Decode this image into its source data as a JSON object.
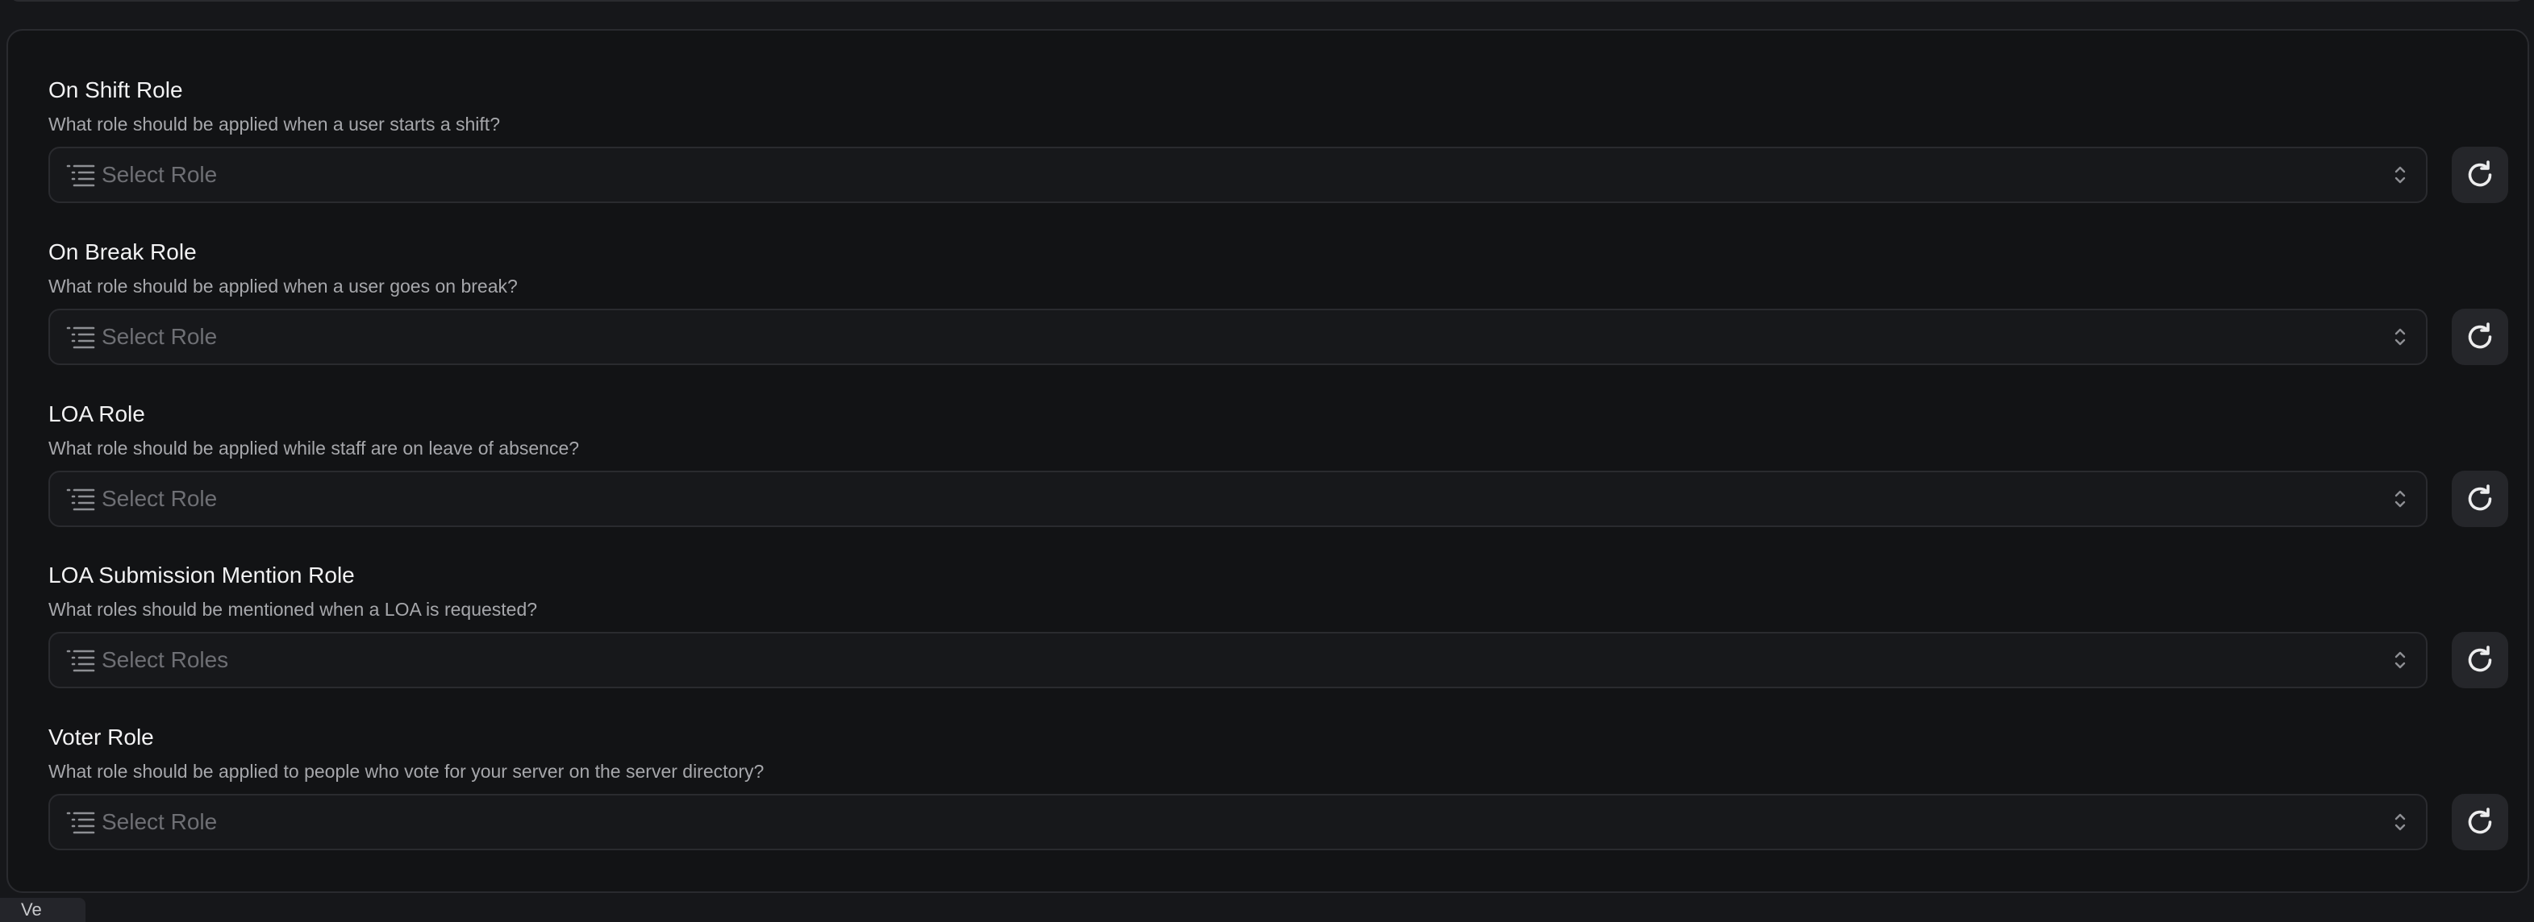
{
  "sections": [
    {
      "title": "On Shift Role",
      "description": "What role should be applied when a user starts a shift?",
      "placeholder": "Select Role"
    },
    {
      "title": "On Break Role",
      "description": "What role should be applied when a user goes on break?",
      "placeholder": "Select Role"
    },
    {
      "title": "LOA Role",
      "description": "What role should be applied while staff are on leave of absence?",
      "placeholder": "Select Role"
    },
    {
      "title": "LOA Submission Mention Role",
      "description": "What roles should be mentioned when a LOA is requested?",
      "placeholder": "Select Roles"
    },
    {
      "title": "Voter Role",
      "description": "What role should be applied to people who vote for your server on the server directory?",
      "placeholder": "Select Role"
    }
  ],
  "icons": {
    "select_leading": "list-icon",
    "select_trailing": "chevron-up-down-icon",
    "action": "refresh-icon"
  },
  "colors": {
    "page_background": "#16171a",
    "panel_background": "#121315",
    "border": "#2a2b2f",
    "title_text": "#f2f2f3",
    "description_text": "#a6a7ab",
    "placeholder_text": "#6e6f74",
    "button_background": "#25262a"
  },
  "bottom_tab": {
    "label": "Ve"
  }
}
